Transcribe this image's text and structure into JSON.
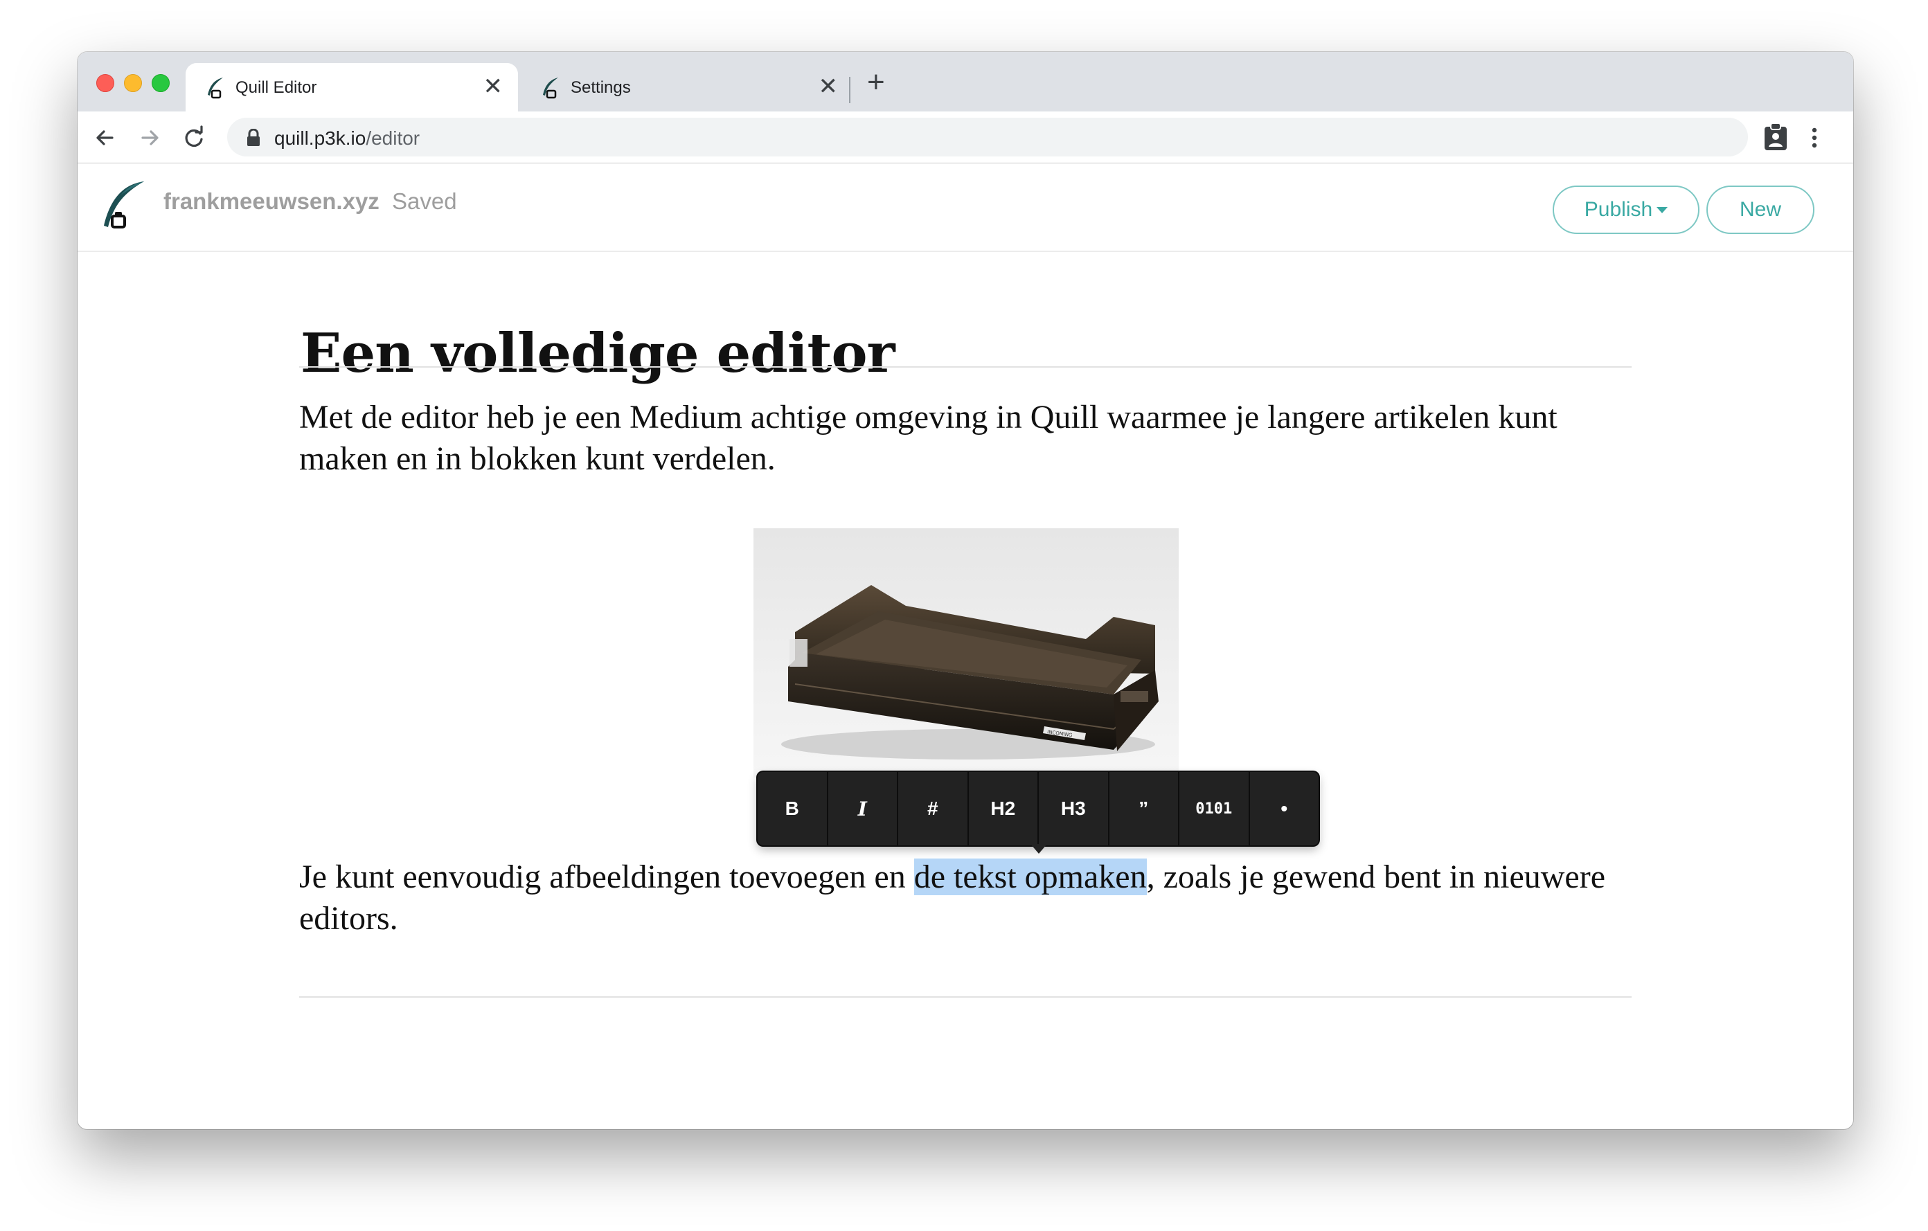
{
  "browser": {
    "tabs": [
      {
        "label": "Quill Editor",
        "active": true
      },
      {
        "label": "Settings",
        "active": false
      }
    ],
    "close_glyph": "✕",
    "new_tab_glyph": "+",
    "url": {
      "host": "quill.p3k.io",
      "path": "/editor"
    }
  },
  "app": {
    "site_name": "frankmeeuwsen.xyz",
    "save_status": "Saved",
    "publish_label": "Publish",
    "new_label": "New",
    "accent_color": "#3aa9a3"
  },
  "article": {
    "title": "Een volledige editor",
    "paragraph_1": "Met de editor heb je een Medium achtige omgeving in Quill waarmee je langere artikelen kunt maken en in blokken kunt verdelen.",
    "paragraph_2_before": "Je kunt eenvoudig afbeeldingen toevoegen en ",
    "paragraph_2_selected": "de tekst opmaken",
    "paragraph_2_after": ", zoals je gewend bent in nieuwere editors.",
    "image_label": "INCOMING",
    "selection_color": "#b5d6f7"
  },
  "format_toolbar": {
    "buttons": [
      "B",
      "I",
      "#",
      "H2",
      "H3",
      "”",
      "0101",
      "•"
    ]
  }
}
